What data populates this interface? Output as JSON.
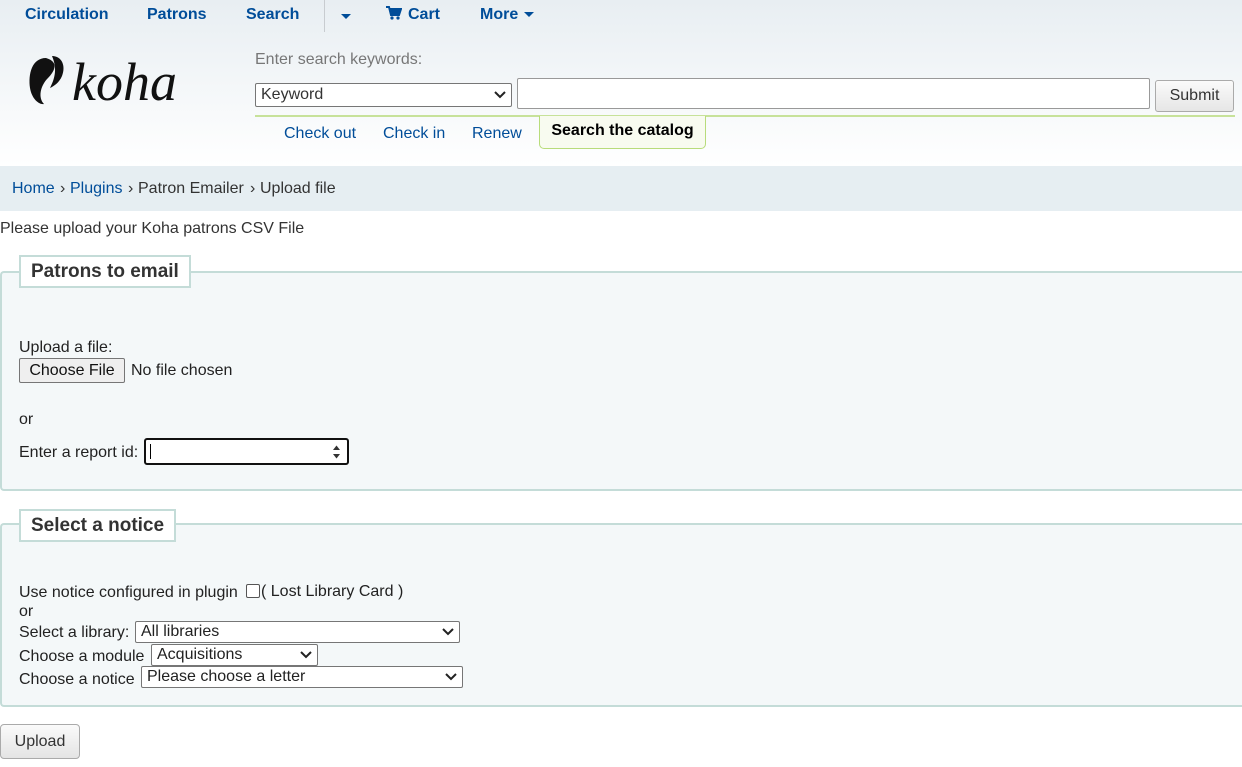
{
  "topnav": {
    "circulation": "Circulation",
    "patrons": "Patrons",
    "search": "Search",
    "cart": "Cart",
    "more": "More"
  },
  "logo_text": "koha",
  "search": {
    "label": "Enter search keywords:",
    "type_selected": "Keyword",
    "query_value": "",
    "submit": "Submit",
    "tabs": [
      "Check out",
      "Check in",
      "Renew"
    ],
    "active_tab": "Search the catalog"
  },
  "breadcrumb": {
    "home": "Home",
    "plugins": "Plugins",
    "plugin": "Patron Emailer",
    "current": "Upload file",
    "separator": "›"
  },
  "intro": "Please upload your Koha patrons CSV File",
  "patrons_section": {
    "legend": "Patrons to email",
    "upload_label": "Upload a file:",
    "choose_file": "Choose File",
    "no_file": "No file chosen",
    "or": "or",
    "report_label": "Enter a report id:",
    "report_value": ""
  },
  "notice_section": {
    "legend": "Select a notice",
    "use_notice_label": "Use notice configured in plugin",
    "use_notice_value": "( Lost Library Card )",
    "or": "or",
    "library_label": "Select a library:",
    "library_selected": "All libraries",
    "module_label": "Choose a module",
    "module_selected": "Acquisitions",
    "notice_label": "Choose a notice",
    "notice_selected": "Please choose a letter"
  },
  "upload_button": "Upload",
  "colors": {
    "link": "#004d99",
    "tab_border": "#b8dc7b",
    "fieldset_bg": "#f4f8f9",
    "fieldset_border": "#c4dcd8",
    "breadcrumb_bg": "#e6eef2"
  }
}
